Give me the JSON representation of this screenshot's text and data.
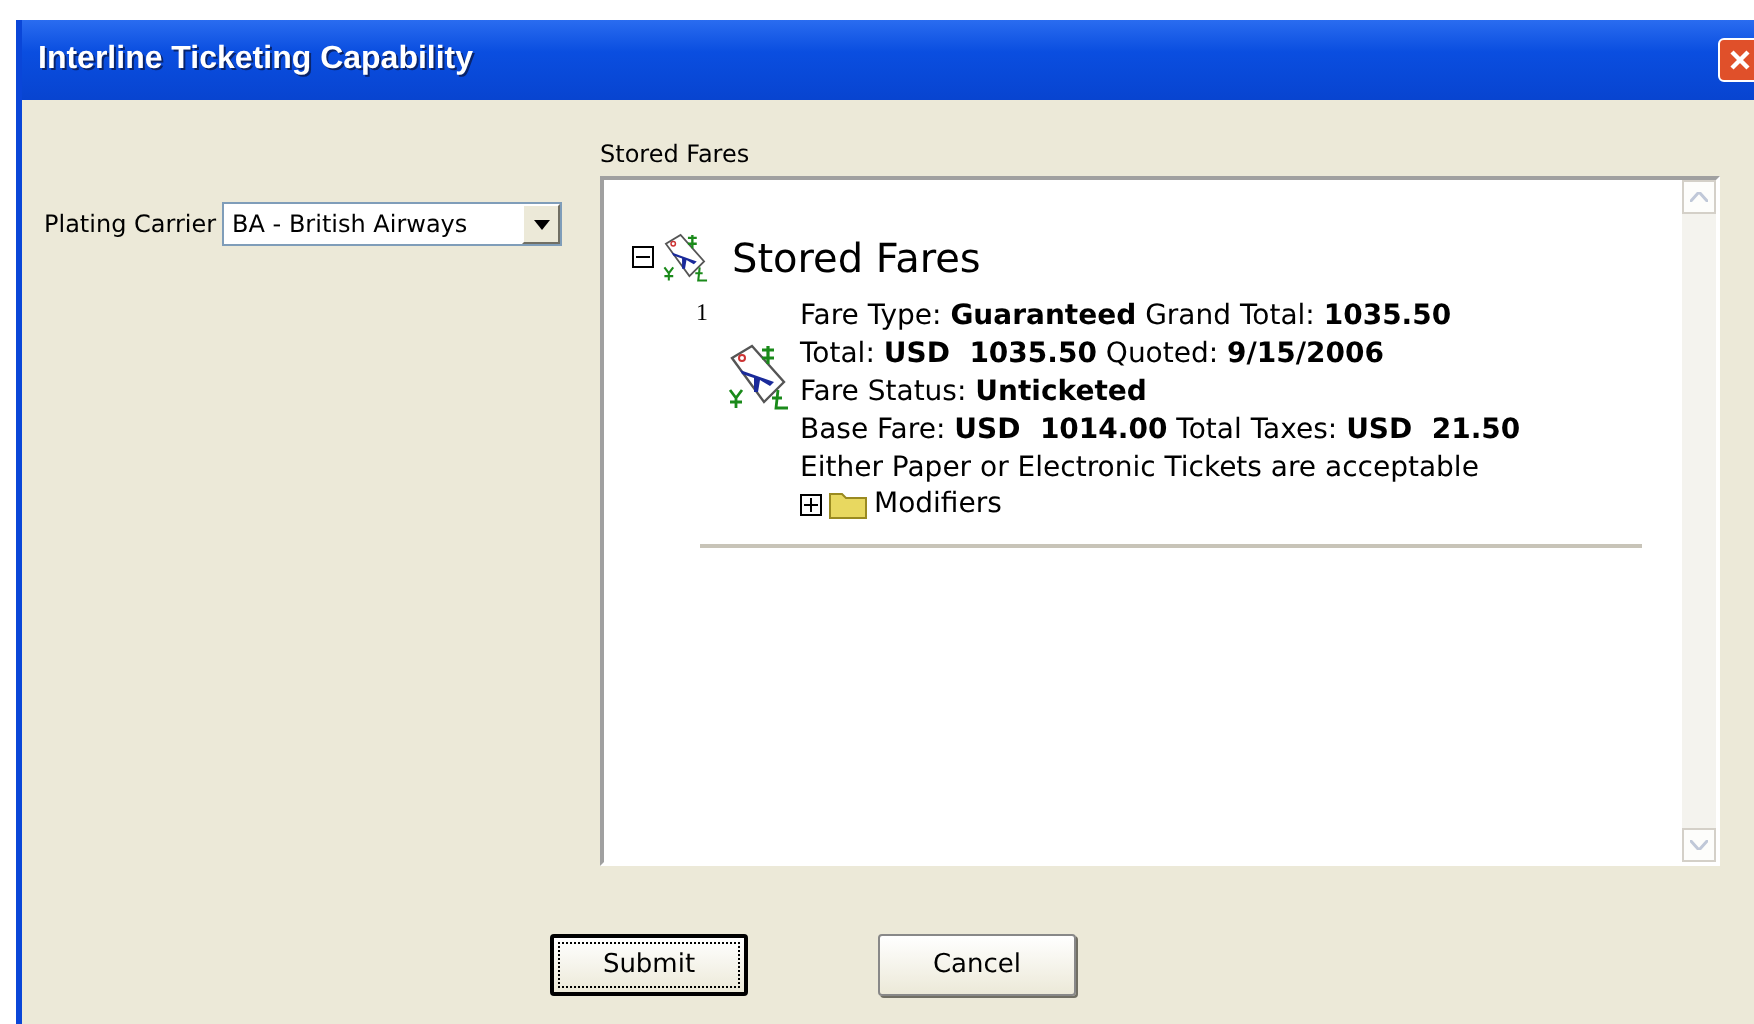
{
  "window": {
    "title": "Interline Ticketing Capability"
  },
  "plating_carrier": {
    "label": "Plating Carrier",
    "value": "BA - British Airways"
  },
  "stored_fares": {
    "label": "Stored Fares",
    "tree": {
      "title": "Stored Fares",
      "expanded": true,
      "fares": [
        {
          "number": "1",
          "lines": [
            "Fare Type: **Guaranteed** Grand Total: **1035.50**",
            "Total: **USD  1035.50** Quoted: **9/15/2006**",
            "Fare Status: **Unticketed**",
            "Base Fare: **USD  1014.00** Total Taxes: **USD  21.50**",
            "Either Paper or Electronic Tickets are acceptable"
          ],
          "children": [
            {
              "label": "Modifiers",
              "expanded": false
            }
          ]
        }
      ]
    }
  },
  "buttons": [
    {
      "label": "Submit",
      "kind": "default"
    },
    {
      "label": "Cancel",
      "kind": "normal"
    }
  ]
}
